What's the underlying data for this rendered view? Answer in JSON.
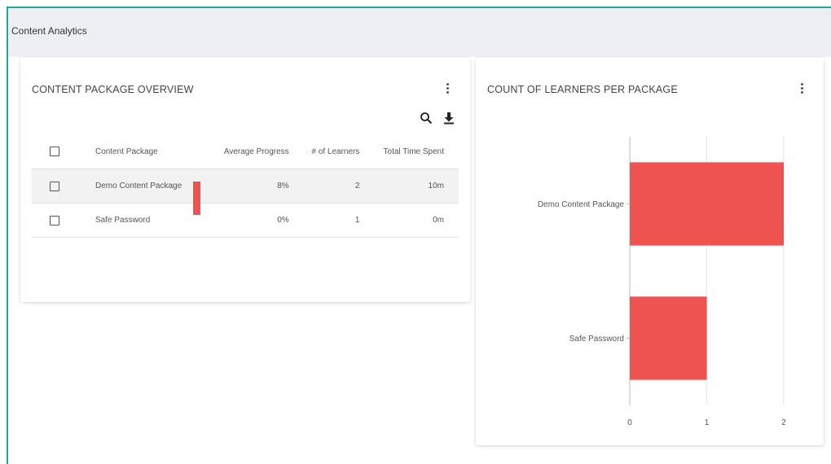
{
  "page": {
    "title": "Content Analytics"
  },
  "overview": {
    "title": "CONTENT PACKAGE OVERVIEW",
    "columns": {
      "package": "Content Package",
      "progress": "Average Progress",
      "learners": "# of Learners",
      "time": "Total Time Spent"
    },
    "rows": [
      {
        "name": "Demo Content Package",
        "progress": "8%",
        "progress_value": 0.08,
        "learners": "2",
        "time": "10m",
        "selected": true
      },
      {
        "name": "Safe Password",
        "progress": "0%",
        "progress_value": 0.0,
        "learners": "1",
        "time": "0m",
        "selected": false
      }
    ]
  },
  "learners_chart": {
    "title": "COUNT OF LEARNERS PER PACKAGE"
  },
  "chart_data": {
    "type": "bar",
    "orientation": "horizontal",
    "title": "COUNT OF LEARNERS PER PACKAGE",
    "categories": [
      "Demo Content Package",
      "Safe Password"
    ],
    "values": [
      2,
      1
    ],
    "xlim": [
      0,
      2
    ],
    "xticks": [
      "0",
      "1",
      "2"
    ],
    "grid": true,
    "bar_color": "#ef5350"
  },
  "colors": {
    "accent": "#1aa99b",
    "bar": "#ef5350",
    "progress": "#ef5350"
  },
  "icons": {
    "menu": "kebab-icon",
    "search": "search-icon",
    "download": "download-icon",
    "checkbox": "checkbox-icon"
  }
}
